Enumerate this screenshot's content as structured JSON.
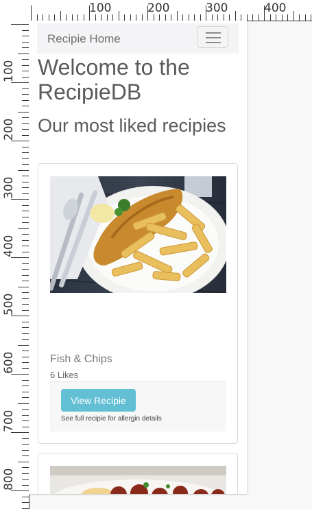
{
  "navbar": {
    "brand": "Recipie Home",
    "toggle_icon": "hamburger-menu-icon"
  },
  "hero": {
    "title": "Welcome to the RecipieDB",
    "subtitle": "Our most liked recipies"
  },
  "recipes": [
    {
      "title": "Fish & Chips",
      "likes": "6 Likes",
      "button_label": "View Recipie",
      "note": "See full recipie for allergin details",
      "image_icon": "fish-and-chips-photo"
    },
    {
      "image_icon": "meatballs-pasta-photo"
    }
  ],
  "ruler": {
    "top_labels": [
      "100",
      "200",
      "300",
      "400"
    ],
    "left_labels": [
      "100",
      "200",
      "300",
      "400",
      "500",
      "600",
      "700",
      "800"
    ]
  },
  "colors": {
    "button": "#62bfd4",
    "navbar_bg": "#f4f4f6"
  }
}
